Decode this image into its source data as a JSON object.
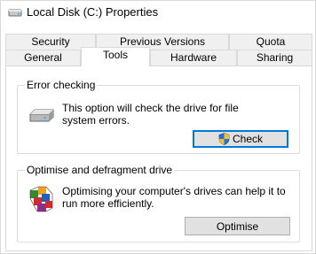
{
  "window": {
    "title": "Local Disk (C:) Properties"
  },
  "tabs": {
    "row1": [
      {
        "label": "Security"
      },
      {
        "label": "Previous Versions"
      },
      {
        "label": "Quota"
      }
    ],
    "row2": [
      {
        "label": "General"
      },
      {
        "label": "Tools",
        "selected": true
      },
      {
        "label": "Hardware"
      },
      {
        "label": "Sharing"
      }
    ]
  },
  "error_checking": {
    "title": "Error checking",
    "description": "This option will check the drive for file system errors.",
    "button_label": "Check",
    "icon": "drive-icon"
  },
  "optimise": {
    "title": "Optimise and defragment drive",
    "description": "Optimising your computer's drives can help it to run more efficiently.",
    "button_label": "Optimise",
    "icon": "defrag-icon"
  },
  "colors": {
    "accent": "#0078d7",
    "border": "#d9d9d9",
    "button": "#e1e1e1"
  }
}
